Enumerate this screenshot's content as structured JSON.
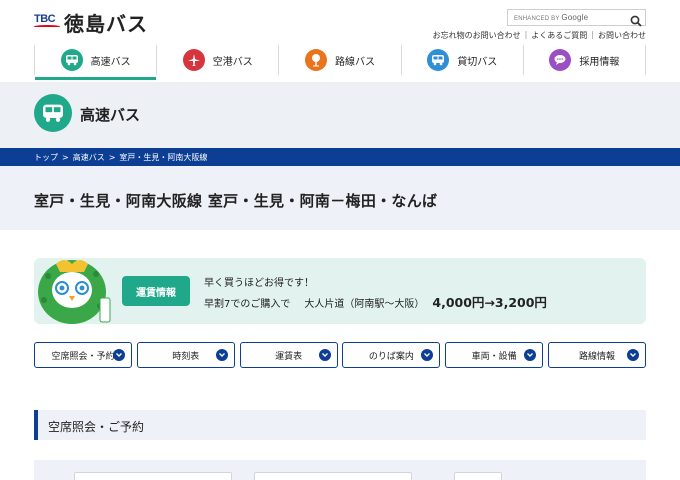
{
  "brand": {
    "mark": "TBC",
    "name": "徳島バス"
  },
  "search": {
    "placeholder_prefix": "ENHANCED BY",
    "placeholder_brand": "Google"
  },
  "util_links": [
    "お忘れ物のお問い合わせ",
    "よくあるご質問",
    "お問い合わせ"
  ],
  "nav": [
    {
      "label": "高速バス",
      "icon": "bus-icon",
      "color": "#1fa88a",
      "active": true
    },
    {
      "label": "空港バス",
      "icon": "airplane-icon",
      "color": "#d6343e",
      "active": false
    },
    {
      "label": "路線バス",
      "icon": "bus-stop-icon",
      "color": "#e8741e",
      "active": false
    },
    {
      "label": "貸切バス",
      "icon": "bus-icon",
      "color": "#2e8fd6",
      "active": false
    },
    {
      "label": "採用情報",
      "icon": "chat-icon",
      "color": "#9b4fc2",
      "active": false
    }
  ],
  "page": {
    "title": "高速バス"
  },
  "breadcrumb": [
    "トップ",
    "高速バス",
    "室戸・生見・阿南大阪線"
  ],
  "route_title": "室戸・生見・阿南大阪線 室戸・生見・阿南－梅田・なんば",
  "fare": {
    "tag": "運賃情報",
    "line1": "早く買うほどお得です！",
    "line2_prefix": "早割7でのご購入で",
    "line2_oneway": "大人片道（阿南駅〜大阪）",
    "line2_price": "4,000円→3,200円"
  },
  "sections": [
    "空席照会・予約",
    "時刻表",
    "運賃表",
    "のりば案内",
    "車両・設備",
    "路線情報"
  ],
  "reservation": {
    "title": "空席照会・ご予約"
  },
  "colors": {
    "primary": "#0c3e93",
    "accent": "#1fa88a",
    "light_bg": "#eef2f8"
  }
}
